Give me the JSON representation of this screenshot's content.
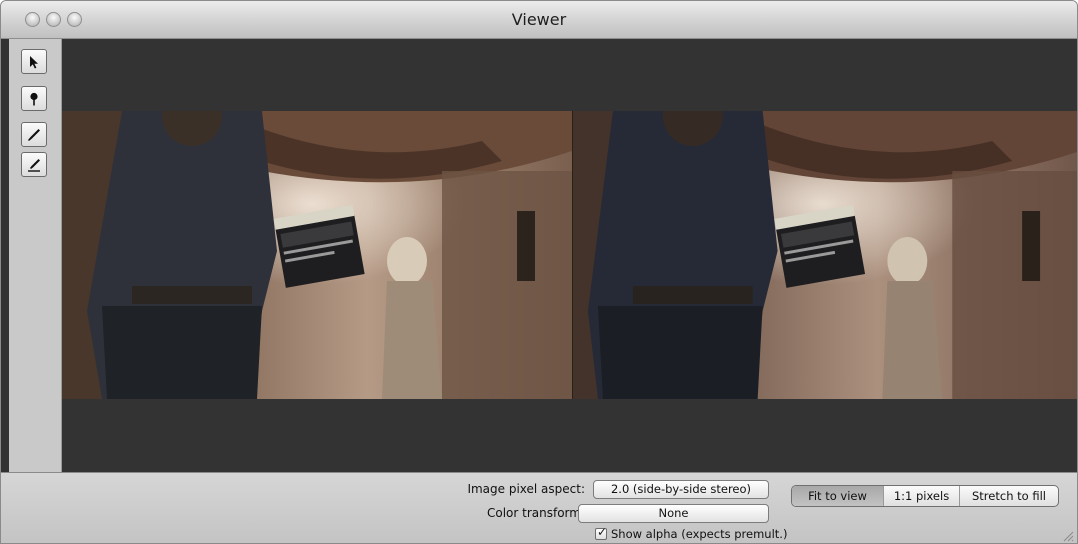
{
  "window": {
    "title": "Viewer"
  },
  "tools": [
    {
      "icon": "arrow-pointer-icon"
    },
    {
      "icon": "magnifier-pin-icon"
    },
    {
      "icon": "eyedropper-icon"
    },
    {
      "icon": "eyedropper-line-icon"
    }
  ],
  "viewer": {
    "description_icon": "side-by-side-stereo-image"
  },
  "bottom": {
    "aspect_label": "Image pixel aspect:",
    "aspect_value": "2.0 (side-by-side stereo)",
    "color_label": "Color transform:",
    "color_value": "None",
    "alpha_label": "Show alpha (expects premult.)",
    "alpha_checked": true,
    "view_modes": [
      "Fit to view",
      "1:1 pixels",
      "Stretch to fill"
    ],
    "active_view_mode": "Fit to view"
  }
}
